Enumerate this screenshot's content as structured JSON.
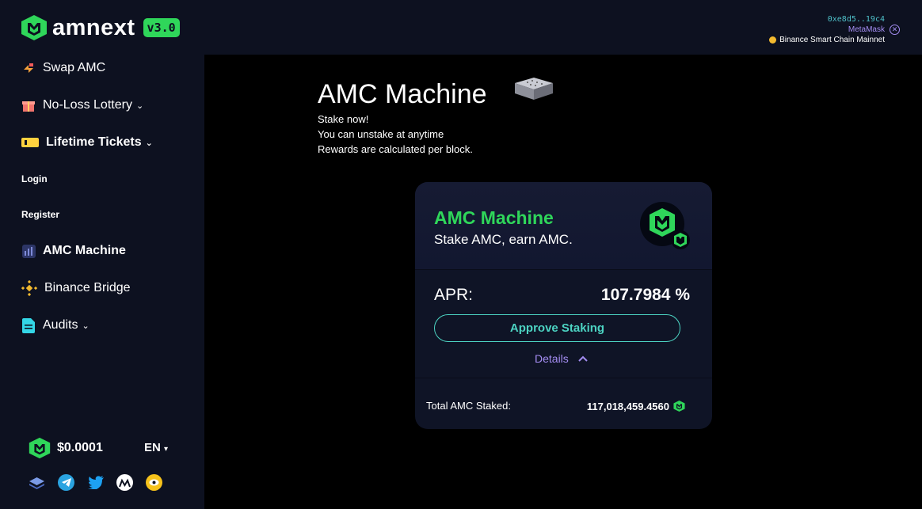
{
  "brand": {
    "name": "amnext",
    "version": "v3.0",
    "accent": "#2fd65a"
  },
  "wallet": {
    "address": "0xe8d5..19c4",
    "provider": "MetaMask",
    "network": "Binance Smart Chain Mainnet"
  },
  "sidebar": {
    "items": [
      {
        "label": "Swap AMC",
        "icon": "swap-icon"
      },
      {
        "label": "No-Loss Lottery",
        "icon": "gift-icon"
      },
      {
        "label": "Lifetime Tickets",
        "icon": "ticket-icon"
      },
      {
        "label": "Login"
      },
      {
        "label": "Register"
      },
      {
        "label": "AMC Machine",
        "icon": "bar-chart-icon"
      },
      {
        "label": "Binance Bridge",
        "icon": "binance-icon"
      },
      {
        "label": "Audits",
        "icon": "document-icon"
      }
    ],
    "price": "$0.0001",
    "language": "EN"
  },
  "hero": {
    "title": "AMC Machine",
    "lines": [
      "Stake now!",
      "You can unstake at anytime",
      "Rewards are calculated per block."
    ]
  },
  "card": {
    "title": "AMC Machine",
    "subtitle": "Stake AMC, earn AMC.",
    "apr_label": "APR:",
    "apr_value": "107.7984 %",
    "approve_label": "Approve Staking",
    "details_label": "Details",
    "total_label": "Total AMC Staked:",
    "total_value": "117,018,459.4560"
  }
}
